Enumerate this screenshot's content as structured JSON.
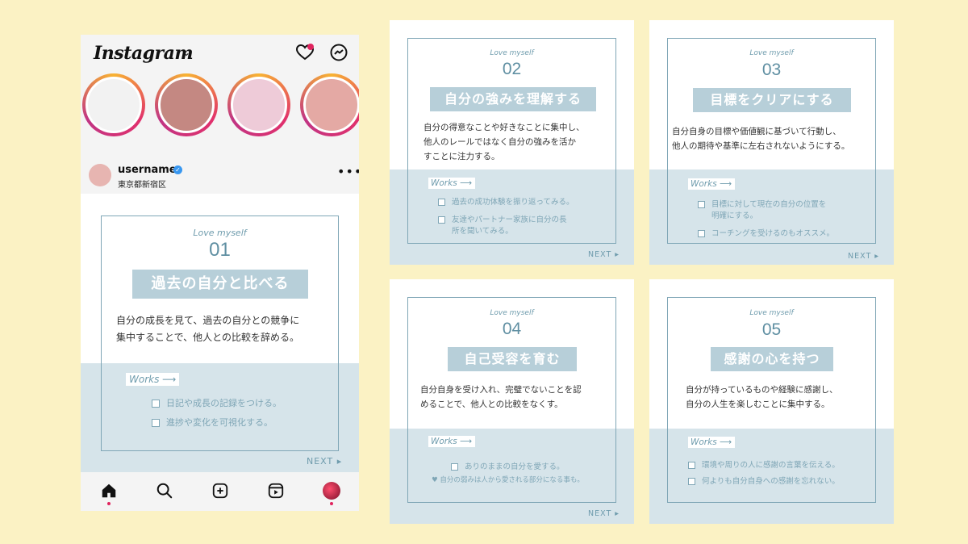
{
  "instagram": {
    "logo": "Instagram",
    "chevron": "⌄",
    "username": "username",
    "verified_mark": "✓",
    "location": "東京都新宿区",
    "more": "•••",
    "stories": [
      "#f2f2f2",
      "#c48882",
      "#eecbd8",
      "#e4a9a4"
    ]
  },
  "cards": [
    {
      "love": "Love myself",
      "num": "01",
      "title": "過去の自分と比べる",
      "desc": [
        "自分の成長を見て、過去の自分との競争に",
        "集中することで、他人との比較を辞める。"
      ],
      "works": "Works",
      "items": [
        "日記や成長の記録をつける。",
        "進捗や変化を可視化する。"
      ],
      "next": "NEXT"
    },
    {
      "love": "Love myself",
      "num": "02",
      "title": "自分の強みを理解する",
      "desc": [
        "自分の得意なことや好きなことに集中し、",
        "他人のレールではなく自分の強みを活か",
        "すことに注力する。"
      ],
      "works": "Works",
      "items": [
        "過去の成功体験を振り返ってみる。",
        "友達やパートナー家族に自分の長",
        "所を聞いてみる。"
      ],
      "next": "NEXT"
    },
    {
      "love": "Love myself",
      "num": "03",
      "title": "目標をクリアにする",
      "desc": [
        "自分自身の目標や価値観に基づいて行動し、",
        "他人の期待や基準に左右されないようにする。"
      ],
      "works": "Works",
      "items": [
        "目標に対して現在の自分の位置を",
        "明確にする。",
        "コーチングを受けるのもオススメ。"
      ],
      "next": "NEXT"
    },
    {
      "love": "Love myself",
      "num": "04",
      "title": "自己受容を育む",
      "desc": [
        "自分自身を受け入れ、完璧でないことを認",
        "めることで、他人との比較をなくす。"
      ],
      "works": "Works",
      "items": [
        "ありのままの自分を愛する。"
      ],
      "note": "♥ 自分の弱みは人から愛される部分になる事も。",
      "next": "NEXT"
    },
    {
      "love": "Love myself",
      "num": "05",
      "title": "感謝の心を持つ",
      "desc": [
        "自分が持っているものや経験に感謝し、",
        "自分の人生を楽しむことに集中する。"
      ],
      "works": "Works",
      "items": [
        "環境や周りの人に感謝の言葉を伝える。",
        "何よりも自分自身への感謝を忘れない。"
      ],
      "next": "NEXT"
    }
  ]
}
